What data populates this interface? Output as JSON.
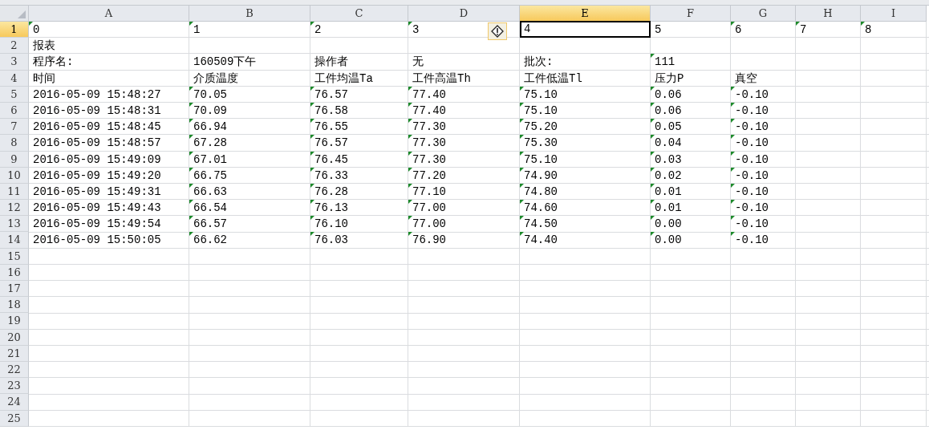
{
  "columns": [
    {
      "letter": "A",
      "selected": false
    },
    {
      "letter": "B",
      "selected": false
    },
    {
      "letter": "C",
      "selected": false
    },
    {
      "letter": "D",
      "selected": false
    },
    {
      "letter": "E",
      "selected": true
    },
    {
      "letter": "F",
      "selected": false
    },
    {
      "letter": "G",
      "selected": false
    },
    {
      "letter": "H",
      "selected": false
    },
    {
      "letter": "I",
      "selected": false
    }
  ],
  "rows": [
    {
      "number": "1",
      "selected": true,
      "cells": [
        {
          "text": "0",
          "flagged": true,
          "selected": false
        },
        {
          "text": "1",
          "flagged": true,
          "selected": false
        },
        {
          "text": "2",
          "flagged": true,
          "selected": false
        },
        {
          "text": "3",
          "flagged": true,
          "selected": false,
          "warning": true
        },
        {
          "text": "4",
          "flagged": false,
          "selected": true
        },
        {
          "text": "5",
          "flagged": false,
          "selected": false
        },
        {
          "text": "6",
          "flagged": true,
          "selected": false
        },
        {
          "text": "7",
          "flagged": true,
          "selected": false
        },
        {
          "text": "8",
          "flagged": true,
          "selected": false
        }
      ]
    },
    {
      "number": "2",
      "selected": false,
      "cells": [
        {
          "text": "报表",
          "flagged": false,
          "selected": false
        }
      ]
    },
    {
      "number": "3",
      "selected": false,
      "cells": [
        {
          "text": "程序名:",
          "flagged": false,
          "selected": false
        },
        {
          "text": "160509下午",
          "flagged": false,
          "selected": false
        },
        {
          "text": "操作者",
          "flagged": false,
          "selected": false
        },
        {
          "text": "无",
          "flagged": false,
          "selected": false
        },
        {
          "text": "批次:",
          "flagged": false,
          "selected": false
        },
        {
          "text": "111",
          "flagged": true,
          "selected": false
        }
      ]
    },
    {
      "number": "4",
      "selected": false,
      "cells": [
        {
          "text": "时间",
          "flagged": false,
          "selected": false
        },
        {
          "text": "介质温度",
          "flagged": false,
          "selected": false
        },
        {
          "text": "工件均温Ta",
          "flagged": false,
          "selected": false
        },
        {
          "text": "工件高温Th",
          "flagged": false,
          "selected": false
        },
        {
          "text": "工件低温Tl",
          "flagged": false,
          "selected": false
        },
        {
          "text": "压力P",
          "flagged": false,
          "selected": false
        },
        {
          "text": "真空",
          "flagged": false,
          "selected": false
        }
      ]
    },
    {
      "number": "5",
      "selected": false,
      "cells": [
        {
          "text": "2016-05-09 15:48:27",
          "flagged": false,
          "selected": false
        },
        {
          "text": "70.05",
          "flagged": true,
          "selected": false
        },
        {
          "text": "76.57",
          "flagged": true,
          "selected": false
        },
        {
          "text": "77.40",
          "flagged": true,
          "selected": false
        },
        {
          "text": "75.10",
          "flagged": true,
          "selected": false
        },
        {
          "text": "0.06",
          "flagged": true,
          "selected": false
        },
        {
          "text": "-0.10",
          "flagged": true,
          "selected": false
        }
      ]
    },
    {
      "number": "6",
      "selected": false,
      "cells": [
        {
          "text": "2016-05-09 15:48:31",
          "flagged": false,
          "selected": false
        },
        {
          "text": "70.09",
          "flagged": true,
          "selected": false
        },
        {
          "text": "76.58",
          "flagged": true,
          "selected": false
        },
        {
          "text": "77.40",
          "flagged": true,
          "selected": false
        },
        {
          "text": "75.10",
          "flagged": true,
          "selected": false
        },
        {
          "text": "0.06",
          "flagged": true,
          "selected": false
        },
        {
          "text": "-0.10",
          "flagged": true,
          "selected": false
        }
      ]
    },
    {
      "number": "7",
      "selected": false,
      "cells": [
        {
          "text": "2016-05-09 15:48:45",
          "flagged": false,
          "selected": false
        },
        {
          "text": "66.94",
          "flagged": true,
          "selected": false
        },
        {
          "text": "76.55",
          "flagged": true,
          "selected": false
        },
        {
          "text": "77.30",
          "flagged": true,
          "selected": false
        },
        {
          "text": "75.20",
          "flagged": true,
          "selected": false
        },
        {
          "text": "0.05",
          "flagged": true,
          "selected": false
        },
        {
          "text": "-0.10",
          "flagged": true,
          "selected": false
        }
      ]
    },
    {
      "number": "8",
      "selected": false,
      "cells": [
        {
          "text": "2016-05-09 15:48:57",
          "flagged": false,
          "selected": false
        },
        {
          "text": "67.28",
          "flagged": true,
          "selected": false
        },
        {
          "text": "76.57",
          "flagged": true,
          "selected": false
        },
        {
          "text": "77.30",
          "flagged": true,
          "selected": false
        },
        {
          "text": "75.30",
          "flagged": true,
          "selected": false
        },
        {
          "text": "0.04",
          "flagged": true,
          "selected": false
        },
        {
          "text": "-0.10",
          "flagged": true,
          "selected": false
        }
      ]
    },
    {
      "number": "9",
      "selected": false,
      "cells": [
        {
          "text": "2016-05-09 15:49:09",
          "flagged": false,
          "selected": false
        },
        {
          "text": "67.01",
          "flagged": true,
          "selected": false
        },
        {
          "text": "76.45",
          "flagged": true,
          "selected": false
        },
        {
          "text": "77.30",
          "flagged": true,
          "selected": false
        },
        {
          "text": "75.10",
          "flagged": true,
          "selected": false
        },
        {
          "text": "0.03",
          "flagged": true,
          "selected": false
        },
        {
          "text": "-0.10",
          "flagged": true,
          "selected": false
        }
      ]
    },
    {
      "number": "10",
      "selected": false,
      "cells": [
        {
          "text": "2016-05-09 15:49:20",
          "flagged": false,
          "selected": false
        },
        {
          "text": "66.75",
          "flagged": true,
          "selected": false
        },
        {
          "text": "76.33",
          "flagged": true,
          "selected": false
        },
        {
          "text": "77.20",
          "flagged": true,
          "selected": false
        },
        {
          "text": "74.90",
          "flagged": true,
          "selected": false
        },
        {
          "text": "0.02",
          "flagged": true,
          "selected": false
        },
        {
          "text": "-0.10",
          "flagged": true,
          "selected": false
        }
      ]
    },
    {
      "number": "11",
      "selected": false,
      "cells": [
        {
          "text": "2016-05-09 15:49:31",
          "flagged": false,
          "selected": false
        },
        {
          "text": "66.63",
          "flagged": true,
          "selected": false
        },
        {
          "text": "76.28",
          "flagged": true,
          "selected": false
        },
        {
          "text": "77.10",
          "flagged": true,
          "selected": false
        },
        {
          "text": "74.80",
          "flagged": true,
          "selected": false
        },
        {
          "text": "0.01",
          "flagged": true,
          "selected": false
        },
        {
          "text": "-0.10",
          "flagged": true,
          "selected": false
        }
      ]
    },
    {
      "number": "12",
      "selected": false,
      "cells": [
        {
          "text": "2016-05-09 15:49:43",
          "flagged": false,
          "selected": false
        },
        {
          "text": "66.54",
          "flagged": true,
          "selected": false
        },
        {
          "text": "76.13",
          "flagged": true,
          "selected": false
        },
        {
          "text": "77.00",
          "flagged": true,
          "selected": false
        },
        {
          "text": "74.60",
          "flagged": true,
          "selected": false
        },
        {
          "text": "0.01",
          "flagged": true,
          "selected": false
        },
        {
          "text": "-0.10",
          "flagged": true,
          "selected": false
        }
      ]
    },
    {
      "number": "13",
      "selected": false,
      "cells": [
        {
          "text": "2016-05-09 15:49:54",
          "flagged": false,
          "selected": false
        },
        {
          "text": "66.57",
          "flagged": true,
          "selected": false
        },
        {
          "text": "76.10",
          "flagged": true,
          "selected": false
        },
        {
          "text": "77.00",
          "flagged": true,
          "selected": false
        },
        {
          "text": "74.50",
          "flagged": true,
          "selected": false
        },
        {
          "text": "0.00",
          "flagged": true,
          "selected": false
        },
        {
          "text": "-0.10",
          "flagged": true,
          "selected": false
        }
      ]
    },
    {
      "number": "14",
      "selected": false,
      "cells": [
        {
          "text": "2016-05-09 15:50:05",
          "flagged": false,
          "selected": false
        },
        {
          "text": "66.62",
          "flagged": true,
          "selected": false
        },
        {
          "text": "76.03",
          "flagged": true,
          "selected": false
        },
        {
          "text": "76.90",
          "flagged": true,
          "selected": false
        },
        {
          "text": "74.40",
          "flagged": true,
          "selected": false
        },
        {
          "text": "0.00",
          "flagged": true,
          "selected": false
        },
        {
          "text": "-0.10",
          "flagged": true,
          "selected": false
        }
      ]
    },
    {
      "number": "15",
      "selected": false
    },
    {
      "number": "16",
      "selected": false
    },
    {
      "number": "17",
      "selected": false
    },
    {
      "number": "18",
      "selected": false
    },
    {
      "number": "19",
      "selected": false
    },
    {
      "number": "20",
      "selected": false
    },
    {
      "number": "21",
      "selected": false
    },
    {
      "number": "22",
      "selected": false
    },
    {
      "number": "23",
      "selected": false
    },
    {
      "number": "24",
      "selected": false
    },
    {
      "number": "25",
      "selected": false
    }
  ]
}
